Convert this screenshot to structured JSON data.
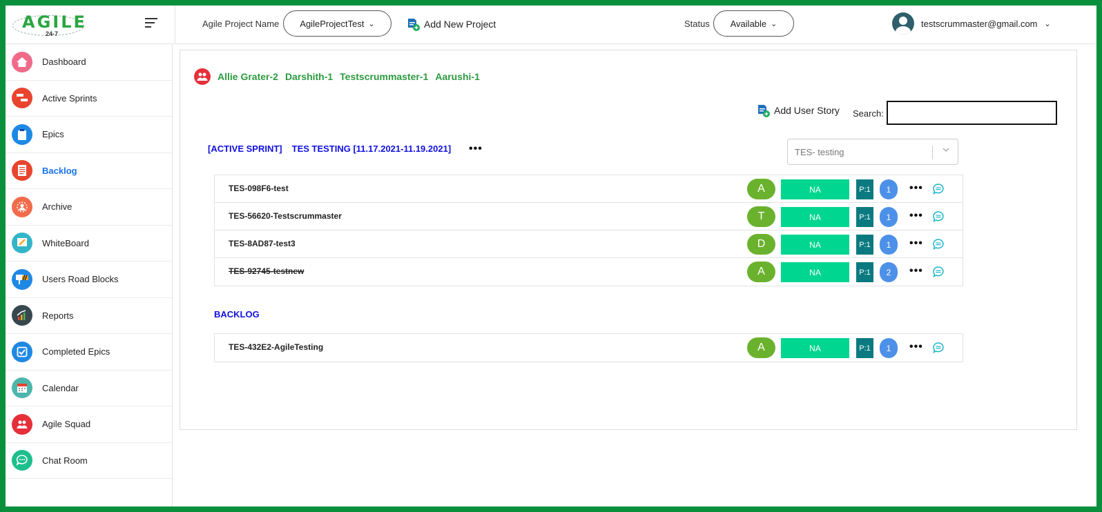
{
  "brand": {
    "logo_text": "AGILE",
    "logo_sub": "24-7"
  },
  "header": {
    "project_label": "Agile Project Name",
    "project_value": "AgileProjectTest",
    "add_project": "Add New Project",
    "status_label": "Status",
    "status_value": "Available",
    "user_email": "testscrummaster@gmail.com"
  },
  "sidebar": {
    "items": [
      {
        "label": "Dashboard",
        "icon": "home-icon",
        "color": "#f06a8a"
      },
      {
        "label": "Active Sprints",
        "icon": "sprints-icon",
        "color": "#e8442e"
      },
      {
        "label": "Epics",
        "icon": "epics-icon",
        "color": "#1e88e5"
      },
      {
        "label": "Backlog",
        "icon": "backlog-icon",
        "color": "#e8442e",
        "active": true
      },
      {
        "label": "Archive",
        "icon": "archive-icon",
        "color": "#f26b4b"
      },
      {
        "label": "WhiteBoard",
        "icon": "whiteboard-icon",
        "color": "#33b5c9"
      },
      {
        "label": "Users Road Blocks",
        "icon": "roadblock-icon",
        "color": "#1e88e5"
      },
      {
        "label": "Reports",
        "icon": "reports-icon",
        "color": "#37474f"
      },
      {
        "label": "Completed Epics",
        "icon": "completed-icon",
        "color": "#1e88e5"
      },
      {
        "label": "Calendar",
        "icon": "calendar-icon",
        "color": "#4db6ac"
      },
      {
        "label": "Agile Squad",
        "icon": "squad-icon",
        "color": "#e5303a"
      },
      {
        "label": "Chat Room",
        "icon": "chat-room-icon",
        "color": "#1dbf8c"
      }
    ]
  },
  "team": {
    "members": [
      "Allie Grater-2",
      "Darshith-1",
      "Testscrummaster-1",
      "Aarushi-1"
    ]
  },
  "toolbar": {
    "add_story": "Add User Story",
    "search_label": "Search:",
    "search_value": ""
  },
  "sprint": {
    "tag": "[ACTIVE SPRINT]",
    "name": "TES TESTING [11.17.2021-11.19.2021]",
    "selected": "TES- testing",
    "menu": "•••"
  },
  "sprint_stories": [
    {
      "title": "TES-098F6-test",
      "avatar": "A",
      "status": "NA",
      "priority": "P:1",
      "count": "1",
      "strike": false
    },
    {
      "title": "TES-56620-Testscrummaster",
      "avatar": "T",
      "status": "NA",
      "priority": "P:1",
      "count": "1",
      "strike": false
    },
    {
      "title": "TES-8AD87-test3",
      "avatar": "D",
      "status": "NA",
      "priority": "P:1",
      "count": "1",
      "strike": false
    },
    {
      "title": "TES-92745-testnew",
      "avatar": "A",
      "status": "NA",
      "priority": "P:1",
      "count": "2",
      "strike": true
    }
  ],
  "backlog": {
    "title": "BACKLOG",
    "stories": [
      {
        "title": "TES-432E2-AgileTesting",
        "avatar": "A",
        "status": "NA",
        "priority": "P:1",
        "count": "1",
        "strike": false
      }
    ]
  },
  "row_menu": "•••"
}
